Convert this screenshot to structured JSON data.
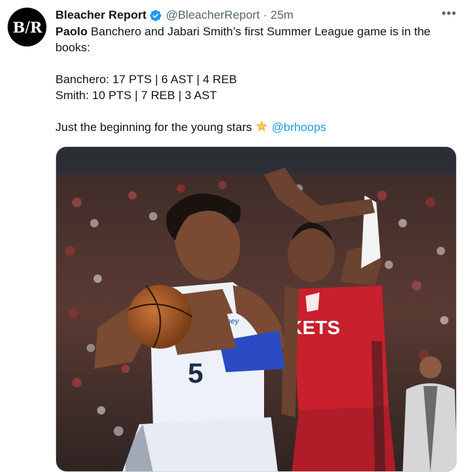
{
  "tweet": {
    "avatar_text_left": "B",
    "avatar_text_right": "R",
    "author_name": "Bleacher Report",
    "handle": "@BleacherReport",
    "separator": "·",
    "time": "25m",
    "more_label": "•••",
    "text": {
      "line1_bold": "Paolo",
      "line1_rest": " Banchero and Jabari Smith’s first Summer League game is in the books:",
      "stat_line_1": "Banchero: 17 PTS | 6 AST | 4 REB",
      "stat_line_2": "Smith: 10 PTS | 7 REB | 3 AST",
      "closing": "Just the beginning for the young stars ",
      "mention": "@brhoops"
    }
  },
  "media": {
    "jersey_number": "5",
    "jersey_sponsor": "Disney",
    "opponent_jersey_text": "KETS"
  },
  "colors": {
    "link": "#1d9bf0",
    "verified": "#1d9bf0",
    "secondary_text": "#536471",
    "magic_jersey": "#eef1f7",
    "rockets_jersey": "#c8202c"
  }
}
